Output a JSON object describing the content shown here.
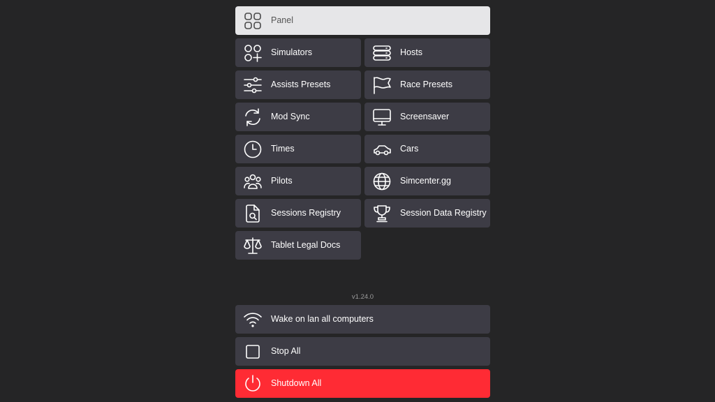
{
  "menu": {
    "panel": "Panel",
    "simulators": "Simulators",
    "hosts": "Hosts",
    "assists_presets": "Assists Presets",
    "race_presets": "Race Presets",
    "mod_sync": "Mod Sync",
    "screensaver": "Screensaver",
    "times": "Times",
    "cars": "Cars",
    "pilots": "Pilots",
    "simcenter": "Simcenter.gg",
    "sessions_registry": "Sessions Registry",
    "session_data_registry": "Session Data Registry",
    "tablet_legal_docs": "Tablet Legal Docs"
  },
  "version": "v1.24.0",
  "actions": {
    "wake_on_lan": "Wake on lan all computers",
    "stop_all": "Stop All",
    "shutdown_all": "Shutdown All"
  },
  "colors": {
    "background": "#252526",
    "button": "#3d3c45",
    "active_button": "#e6e6e8",
    "danger": "#ff2b34"
  },
  "icons": {
    "panel": "grid-icon",
    "simulators": "apps-add-icon",
    "hosts": "server-icon",
    "assists_presets": "sliders-icon",
    "race_presets": "flag-icon",
    "mod_sync": "refresh-icon",
    "screensaver": "monitor-icon",
    "times": "clock-icon",
    "cars": "car-icon",
    "pilots": "users-icon",
    "simcenter": "globe-icon",
    "sessions_registry": "file-search-icon",
    "session_data_registry": "trophy-icon",
    "tablet_legal_docs": "scale-icon",
    "wake_on_lan": "wifi-icon",
    "stop_all": "square-icon",
    "shutdown_all": "power-icon"
  }
}
